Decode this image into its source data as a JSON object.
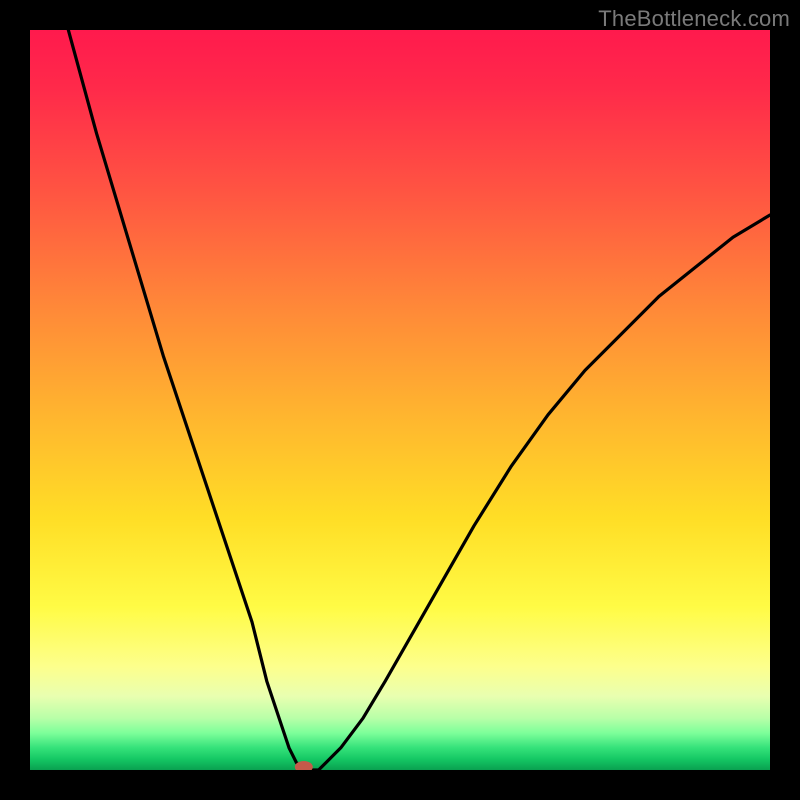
{
  "watermark": {
    "text": "TheBottleneck.com"
  },
  "chart_data": {
    "type": "line",
    "title": "",
    "xlabel": "",
    "ylabel": "",
    "xlim": [
      0,
      100
    ],
    "ylim": [
      0,
      100
    ],
    "series": [
      {
        "name": "bottleneck-curve",
        "x": [
          0,
          3,
          6,
          9,
          12,
          15,
          18,
          21,
          24,
          27,
          30,
          32,
          34,
          35,
          36,
          37,
          38,
          39,
          40,
          42,
          45,
          48,
          52,
          56,
          60,
          65,
          70,
          75,
          80,
          85,
          90,
          95,
          100
        ],
        "values": [
          120,
          108,
          97,
          86,
          76,
          66,
          56,
          47,
          38,
          29,
          20,
          12,
          6,
          3,
          1,
          0,
          0,
          0,
          1,
          3,
          7,
          12,
          19,
          26,
          33,
          41,
          48,
          54,
          59,
          64,
          68,
          72,
          75
        ]
      }
    ],
    "marker": {
      "x": 37,
      "y": 0,
      "color": "#c45a4a",
      "rx": 9,
      "ry": 6
    },
    "gradient_stops": [
      {
        "pct": 0,
        "color": "#ff1a4d"
      },
      {
        "pct": 22,
        "color": "#ff5542"
      },
      {
        "pct": 52,
        "color": "#ffb52f"
      },
      {
        "pct": 78,
        "color": "#fffb45"
      },
      {
        "pct": 93,
        "color": "#b8ffa8"
      },
      {
        "pct": 100,
        "color": "#0aa050"
      }
    ]
  }
}
